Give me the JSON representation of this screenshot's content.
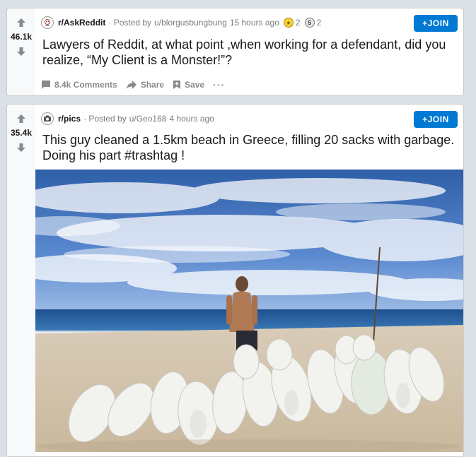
{
  "posts": [
    {
      "score": "46.1k",
      "subreddit": "r/AskReddit",
      "posted_by": "· Posted by",
      "user": "u/blorgusbungbung",
      "time": "15 hours ago",
      "awards": [
        {
          "icon": "gold-award-icon",
          "count": "2"
        },
        {
          "icon": "silver-award-icon",
          "count": "2"
        }
      ],
      "join_label": "+JOIN",
      "title": "Lawyers of Reddit, at what point ,when working for a defendant, did you realize, “My Client is a Monster!”?",
      "actions": {
        "comments": "8.4k Comments",
        "share": "Share",
        "save": "Save",
        "more": "···"
      }
    },
    {
      "score": "35.4k",
      "subreddit": "r/pics",
      "posted_by": "· Posted by",
      "user": "u/Geo168",
      "time": "4 hours ago",
      "join_label": "+JOIN",
      "title": "This guy cleaned a 1.5km beach in Greece, filling 20 sacks with garbage. Doing his part #trashtag !",
      "image": "beach-cleanup-photo"
    }
  ],
  "colors": {
    "background": "#dae0e6",
    "join_button": "#0079d3",
    "meta_text": "#787c7e",
    "action_text": "#878a8c"
  }
}
